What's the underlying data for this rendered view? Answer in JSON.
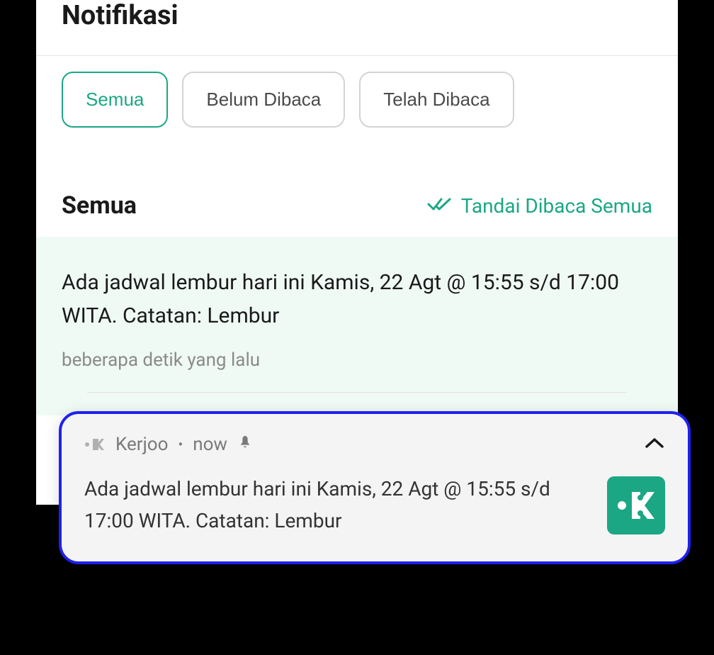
{
  "header": {
    "title": "Notifikasi"
  },
  "filters": {
    "items": [
      {
        "label": "Semua",
        "active": true
      },
      {
        "label": "Belum Dibaca",
        "active": false
      },
      {
        "label": "Telah Dibaca",
        "active": false
      }
    ]
  },
  "section": {
    "title": "Semua",
    "mark_all_label": "Tandai Dibaca Semua"
  },
  "notifications": [
    {
      "text": "Ada jadwal lembur hari ini Kamis, 22 Agt @ 15:55 s/d 17:00 WITA. Catatan: Lembur",
      "time": "beberapa detik yang lalu"
    }
  ],
  "push": {
    "app_name": "Kerjoo",
    "time": "now",
    "text": "Ada jadwal lembur hari ini Kamis, 22 Agt @ 15:55 s/d 17:00 WITA. Catatan: Lembur"
  },
  "colors": {
    "accent": "#1ba784",
    "highlight_border": "#2020f0",
    "unread_bg": "#f0faf5"
  }
}
